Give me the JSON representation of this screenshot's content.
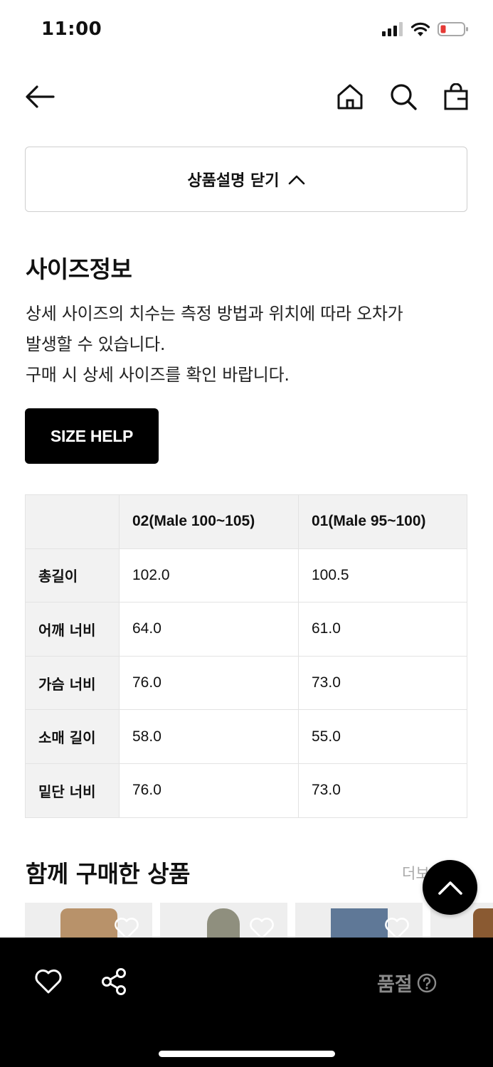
{
  "status_bar": {
    "time": "11:00"
  },
  "collapse_button": {
    "label": "상품설명 닫기"
  },
  "size_info": {
    "title": "사이즈정보",
    "description_lines": [
      "상세 사이즈의 치수는 측정 방법과 위치에 따라 오차가",
      "발생할 수 있습니다.",
      "구매 시 상세 사이즈를 확인 바랍니다."
    ],
    "size_help_label": "SIZE HELP",
    "columns": [
      "",
      "02(Male 100~105)",
      "01(Male 95~100)"
    ],
    "rows": [
      {
        "label": "총길이",
        "values": [
          "102.0",
          "100.5"
        ]
      },
      {
        "label": "어깨 너비",
        "values": [
          "64.0",
          "61.0"
        ]
      },
      {
        "label": "가슴 너비",
        "values": [
          "76.0",
          "73.0"
        ]
      },
      {
        "label": "소매 길이",
        "values": [
          "58.0",
          "55.0"
        ]
      },
      {
        "label": "밑단 너비",
        "values": [
          "76.0",
          "73.0"
        ]
      }
    ]
  },
  "together": {
    "title": "함께 구매한 상품",
    "more_label": "더보"
  },
  "bottom_bar": {
    "soldout_label": "품절"
  },
  "colors": {
    "accent": "#000000",
    "status_battery": "#e53935",
    "muted": "#8a8a8a"
  }
}
